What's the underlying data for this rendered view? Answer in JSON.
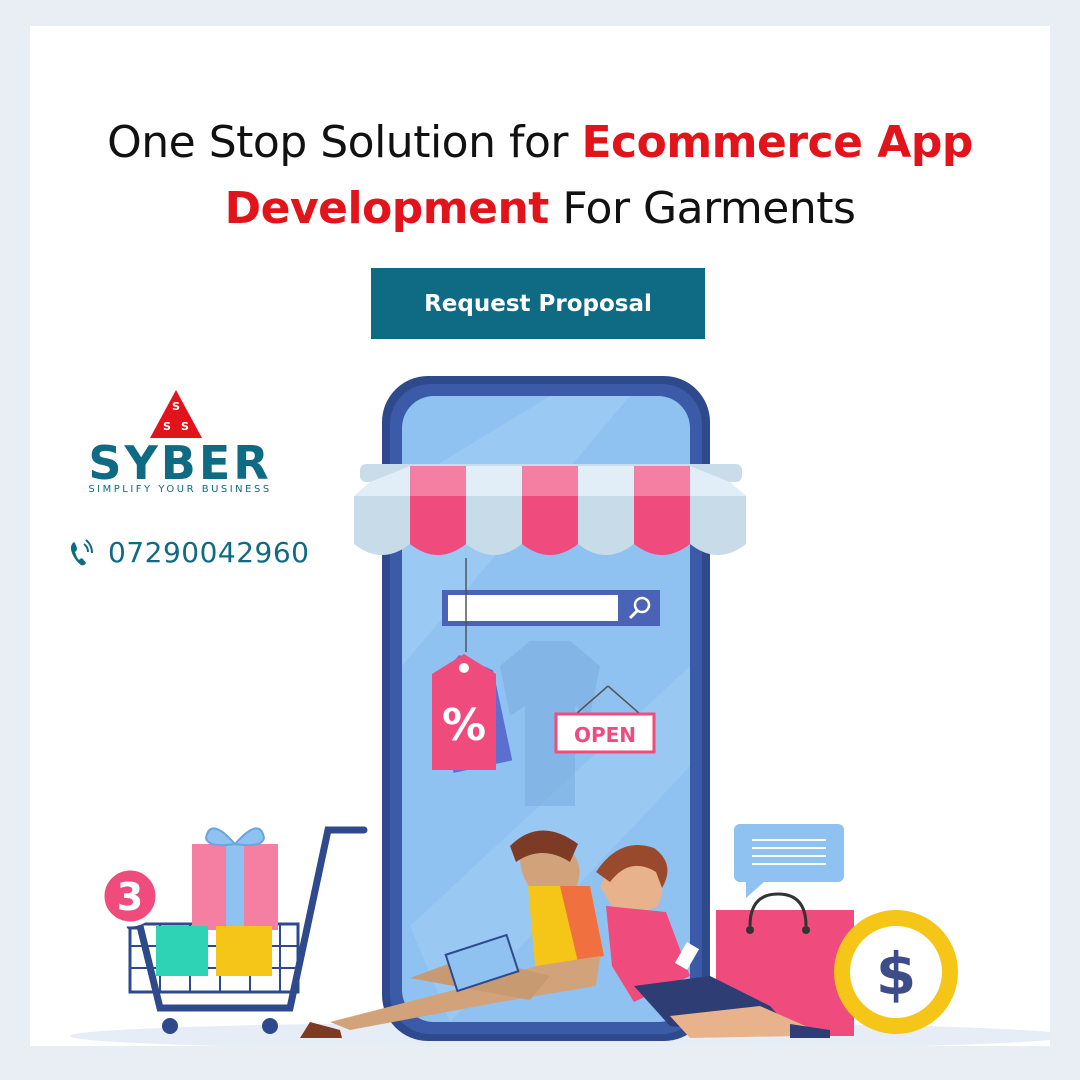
{
  "headline": {
    "part1": "One Stop Solution for ",
    "highlight1": "Ecommerce App",
    "highlight2": "Development",
    "part2": " For Garments"
  },
  "cta_label": "Request Proposal",
  "brand": {
    "name": "SYBER",
    "tagline": "SIMPLIFY YOUR BUSINESS",
    "mark_letters": "SSS"
  },
  "contact": {
    "phone": "07290042960",
    "icon": "phone-icon"
  },
  "illustration": {
    "open_sign": "OPEN",
    "discount_symbol": "%",
    "cart_count": "3",
    "coin_symbol": "$"
  },
  "colors": {
    "accent": "#0f6a84",
    "highlight": "#e3131b",
    "phone_body": "#2e4a8c",
    "screen": "#8fc2f1",
    "pink": "#ef4b7d",
    "coin": "#f5c518"
  }
}
